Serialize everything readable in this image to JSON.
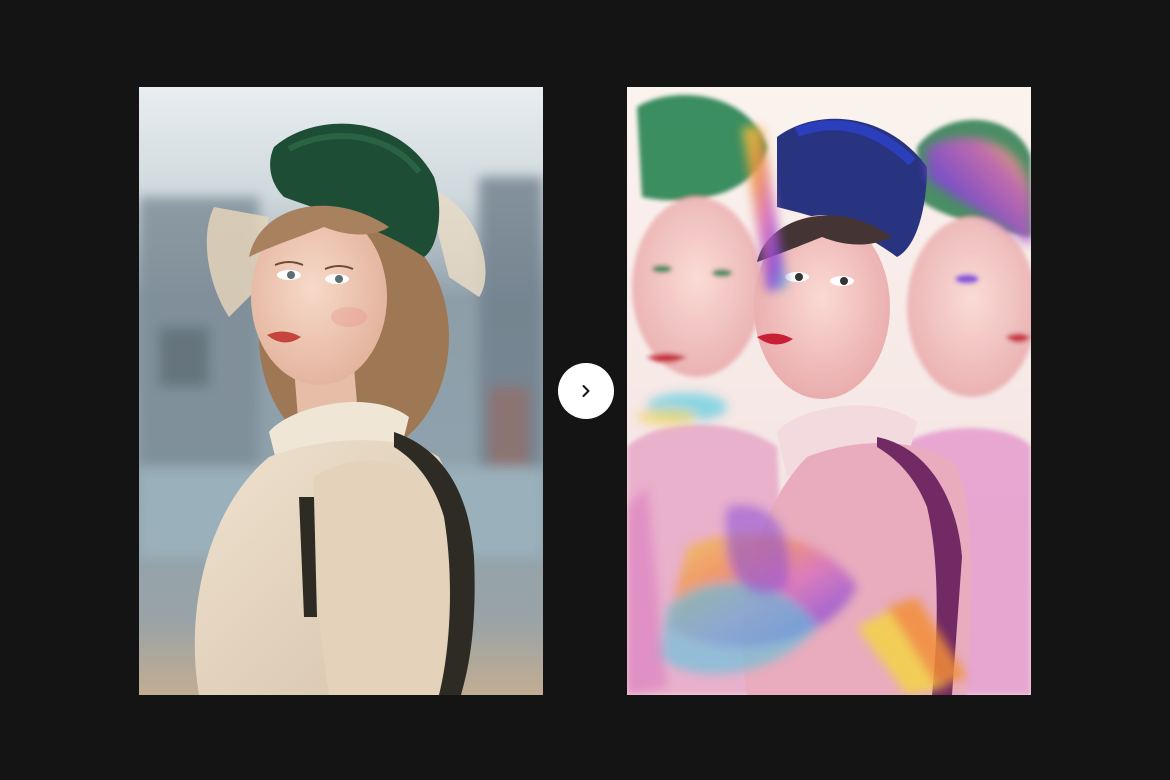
{
  "comparison": {
    "before_image": {
      "label": "",
      "description_icon": "portrait-photo",
      "palette": {
        "sky": "#e6ebee",
        "background": "#8fa1ad",
        "ground": "#b9a894",
        "hat": "#1f4d36",
        "hair": "#a27c5a",
        "skin": "#f0cab6",
        "lips": "#c8443b",
        "blouse": "#e7d8c4",
        "strap": "#2b2a22"
      }
    },
    "after_image": {
      "label": "",
      "description_icon": "prism-glitch-portrait",
      "palette": {
        "base": "#f6eaea",
        "magenta": "#d35db7",
        "violet": "#7b3bd8",
        "cyan": "#38c6e0",
        "yellow": "#f4d23a",
        "orange": "#f28a2e",
        "blue": "#2238c9",
        "green": "#1e7d49",
        "lips": "#c4152a"
      }
    },
    "next_button": {
      "icon": "chevron-right-icon",
      "color": "#ffffff",
      "icon_color": "#141414"
    }
  }
}
